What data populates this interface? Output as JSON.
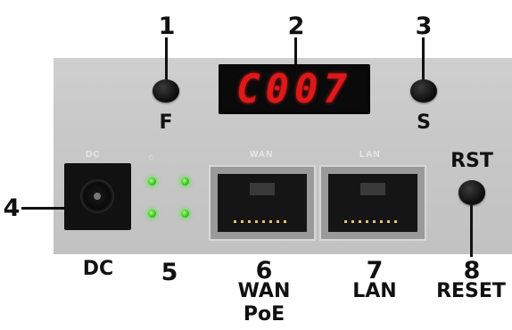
{
  "callouts": {
    "c1": {
      "num": "1",
      "caption": "F"
    },
    "c2": {
      "num": "2"
    },
    "c3": {
      "num": "3",
      "caption": "S"
    },
    "c4": {
      "num": "4"
    },
    "c5": {
      "num": "5"
    },
    "c6": {
      "num": "6",
      "caption_line1": "WAN",
      "caption_line2": "PoE"
    },
    "c7": {
      "num": "7",
      "caption": "LAN"
    },
    "c8": {
      "num": "8",
      "caption": "RESET"
    }
  },
  "panel": {
    "display_text": "C007",
    "dc_label": "DC",
    "dc_silk": "DC",
    "wan_silk": "WAN",
    "lan_silk": "LAN",
    "rst_label": "RST",
    "display_color": "#e01818",
    "led_color": "#3fd42a"
  }
}
